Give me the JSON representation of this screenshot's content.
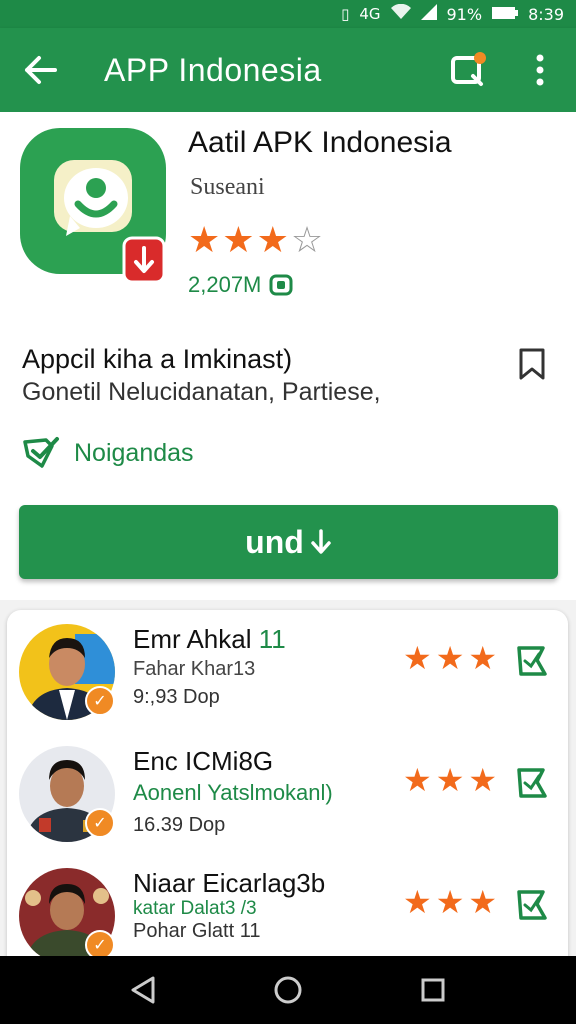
{
  "status_bar": {
    "icons": [
      "vibrate-icon",
      "signal-icon",
      "wifi-icon",
      "cell-icon",
      "battery-icon"
    ],
    "network": "4G",
    "battery": "91%",
    "time": "8:39"
  },
  "app_bar": {
    "title": "APP Indonesia",
    "color": "#23924d"
  },
  "app": {
    "name": "Aatil APK Indonesia",
    "developer": "Suseani",
    "rating_stars": 3,
    "rating_max": 4,
    "size": "2,207M"
  },
  "description": {
    "title": "Appcil kiha a Imkinast)",
    "subtitle": "Gonetil Nelucidanatan, Partiese,"
  },
  "verified": {
    "label": "Noigandas"
  },
  "install_button": {
    "label": "und",
    "icon": "download-arrow-icon"
  },
  "reviews": [
    {
      "name": "Emr Ahkal ",
      "name_num": "11",
      "subtitle": "Fahar Khar13",
      "meta": "9:,93 Dop",
      "stars": 3,
      "subtitle_style": "gray"
    },
    {
      "name": "Enc ICMi8G",
      "name_num": "",
      "subtitle": "Aonenl Yatslmokanl)",
      "meta": "16.39 Dop",
      "stars": 3,
      "subtitle_style": "green"
    },
    {
      "name": "Niaar Eicarlag3b",
      "name_num": "",
      "subtitle": "katar Dalat3 /3",
      "meta": "Pohar Glatt 11",
      "stars": 3,
      "subtitle_style": "green-small"
    }
  ],
  "colors": {
    "brand_green": "#23924d",
    "star_orange": "#f26a1b",
    "badge_orange": "#f08a24"
  }
}
